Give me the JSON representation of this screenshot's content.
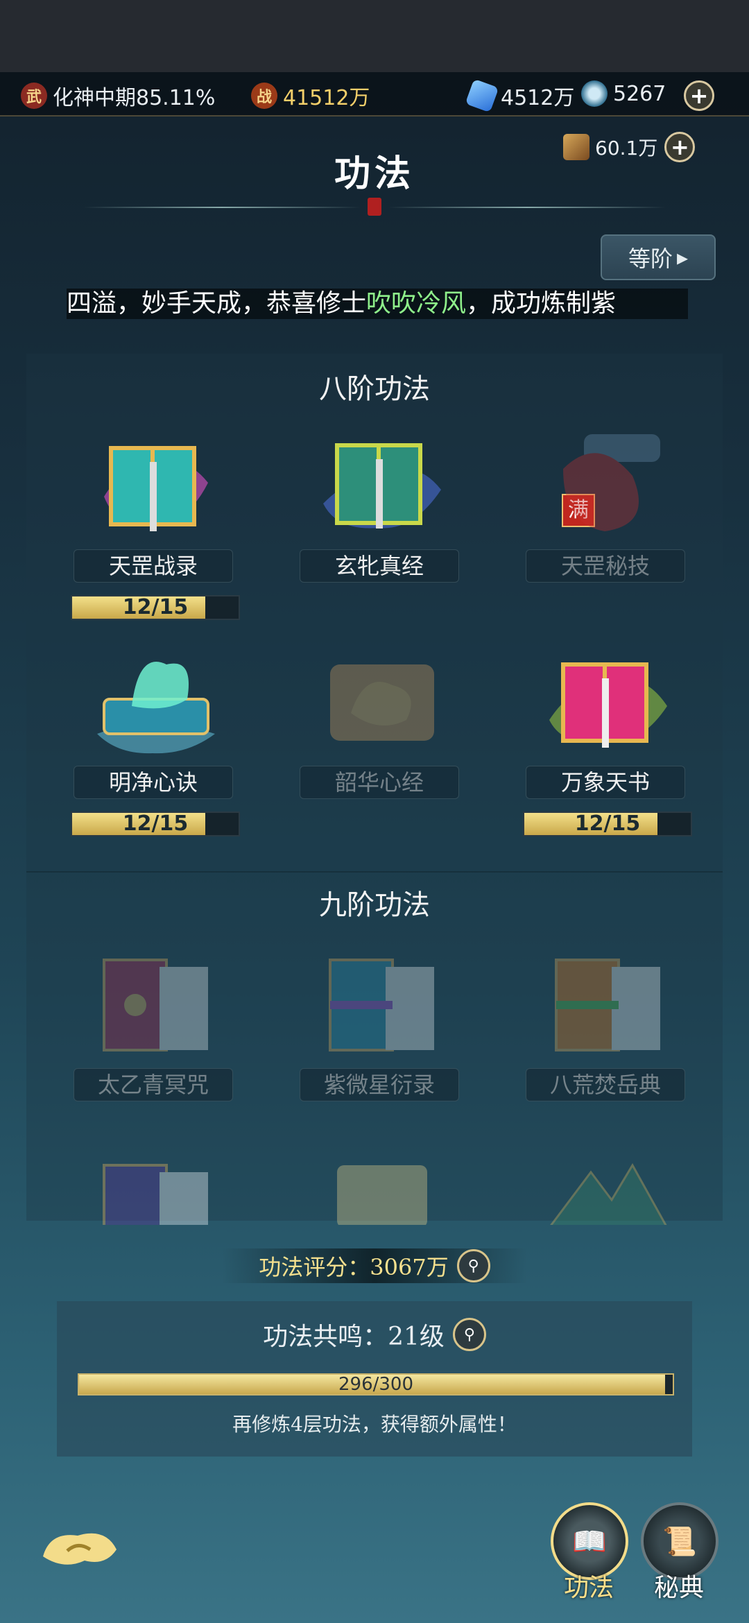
{
  "resources": {
    "realm": "化神中期85.11%",
    "power": "41512万",
    "crystal": "4512万",
    "coin": "5267",
    "scroll": "60.1万",
    "realm_badge": "武",
    "power_badge": "战"
  },
  "page_title": "功法",
  "tier_button": "等阶",
  "ticker": {
    "before": "四溢，妙手天成，恭喜修士",
    "name": "吹吹冷风",
    "after": "，成功炼制紫"
  },
  "section8": {
    "title": "八阶功法",
    "items": [
      {
        "name": "天罡战录",
        "progress": "12/15",
        "fraction": 0.8,
        "icon": "book-gold-teal-icon"
      },
      {
        "name": "玄牝真经",
        "badge": "满",
        "icon": "book-green-icon"
      },
      {
        "name": "天罡秘技",
        "icon": "scroll-red-icon"
      },
      {
        "name": "明净心诀",
        "progress": "12/15",
        "fraction": 0.8,
        "icon": "book-qilin-icon"
      },
      {
        "name": "韶华心经",
        "icon": "scroll-dragon-icon"
      },
      {
        "name": "万象天书",
        "progress": "12/15",
        "fraction": 0.8,
        "icon": "book-pink-icon"
      }
    ]
  },
  "section9": {
    "title": "九阶功法",
    "items": [
      {
        "name": "太乙青冥咒",
        "icon": "book-red-icon"
      },
      {
        "name": "紫微星衍录",
        "icon": "book-blue-icon"
      },
      {
        "name": "八荒焚岳典",
        "icon": "book-orange-icon"
      }
    ]
  },
  "score": {
    "label": "功法评分：",
    "value": "3067万"
  },
  "resonance": {
    "label": "功法共鸣：",
    "level": "21级",
    "progress": "296/300",
    "fraction": 0.987,
    "hint": "再修炼4层功法，获得额外属性！"
  },
  "bottom": {
    "skills": "功法",
    "secrets": "秘典"
  },
  "colors": {
    "gold": "#f3e08a",
    "highlight_name": "#8ef08a",
    "full_badge": "#c0271f"
  }
}
